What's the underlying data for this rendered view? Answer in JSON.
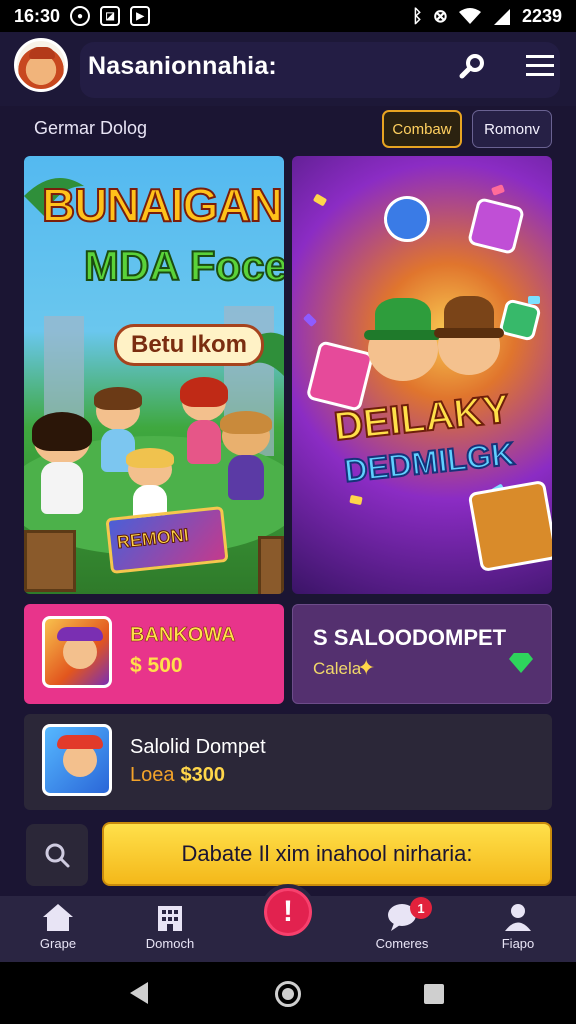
{
  "status_bar": {
    "time": "16:30",
    "right_time": "2239",
    "left_icons": [
      "record-icon",
      "gallery-icon",
      "play-store-icon"
    ],
    "right_icons": [
      "bluetooth-icon",
      "vibrate-icon",
      "wifi-icon",
      "signal-icon"
    ]
  },
  "header": {
    "title": "Nasanionnahia:",
    "icons": [
      "avatar",
      "search-icon",
      "menu-icon"
    ]
  },
  "subbar": {
    "label": "Germar Dolog",
    "chips": [
      "Combaw",
      "Romonv"
    ]
  },
  "banners": {
    "left": {
      "title_line1": "BUNAIGAN",
      "title_line2": "MDA Focen",
      "badge": "Betu Ikom",
      "box_label": "REMONI"
    },
    "right": {
      "title_line1": "DEILAKY",
      "title_line2": "DEDMILGK"
    }
  },
  "cards": [
    {
      "title": "BANKOWA",
      "price": "$ 500",
      "color": "#e8348b"
    },
    {
      "title": "S SALOODOMPET",
      "sub": "Calela",
      "color": "#54306f"
    },
    {
      "title": "Salolid Dompet",
      "sub": "Loea",
      "price": "$300"
    }
  ],
  "cta": {
    "label": "Dabate Il xim inahool nirharia:"
  },
  "bottom_nav": {
    "items": [
      {
        "label": "Grape",
        "icon": "home-icon"
      },
      {
        "label": "Domoch",
        "icon": "building-icon"
      },
      {
        "label": "Comeres",
        "icon": "chat-icon"
      },
      {
        "label": "Fiapo",
        "icon": "profile-icon"
      }
    ],
    "fab_symbol": "!",
    "notification_count": "1"
  },
  "colors": {
    "background": "#1b1533",
    "accent_yellow": "#ffe04a",
    "pink": "#e8348b",
    "purple": "#54306f",
    "fab_red": "#e2224f"
  }
}
